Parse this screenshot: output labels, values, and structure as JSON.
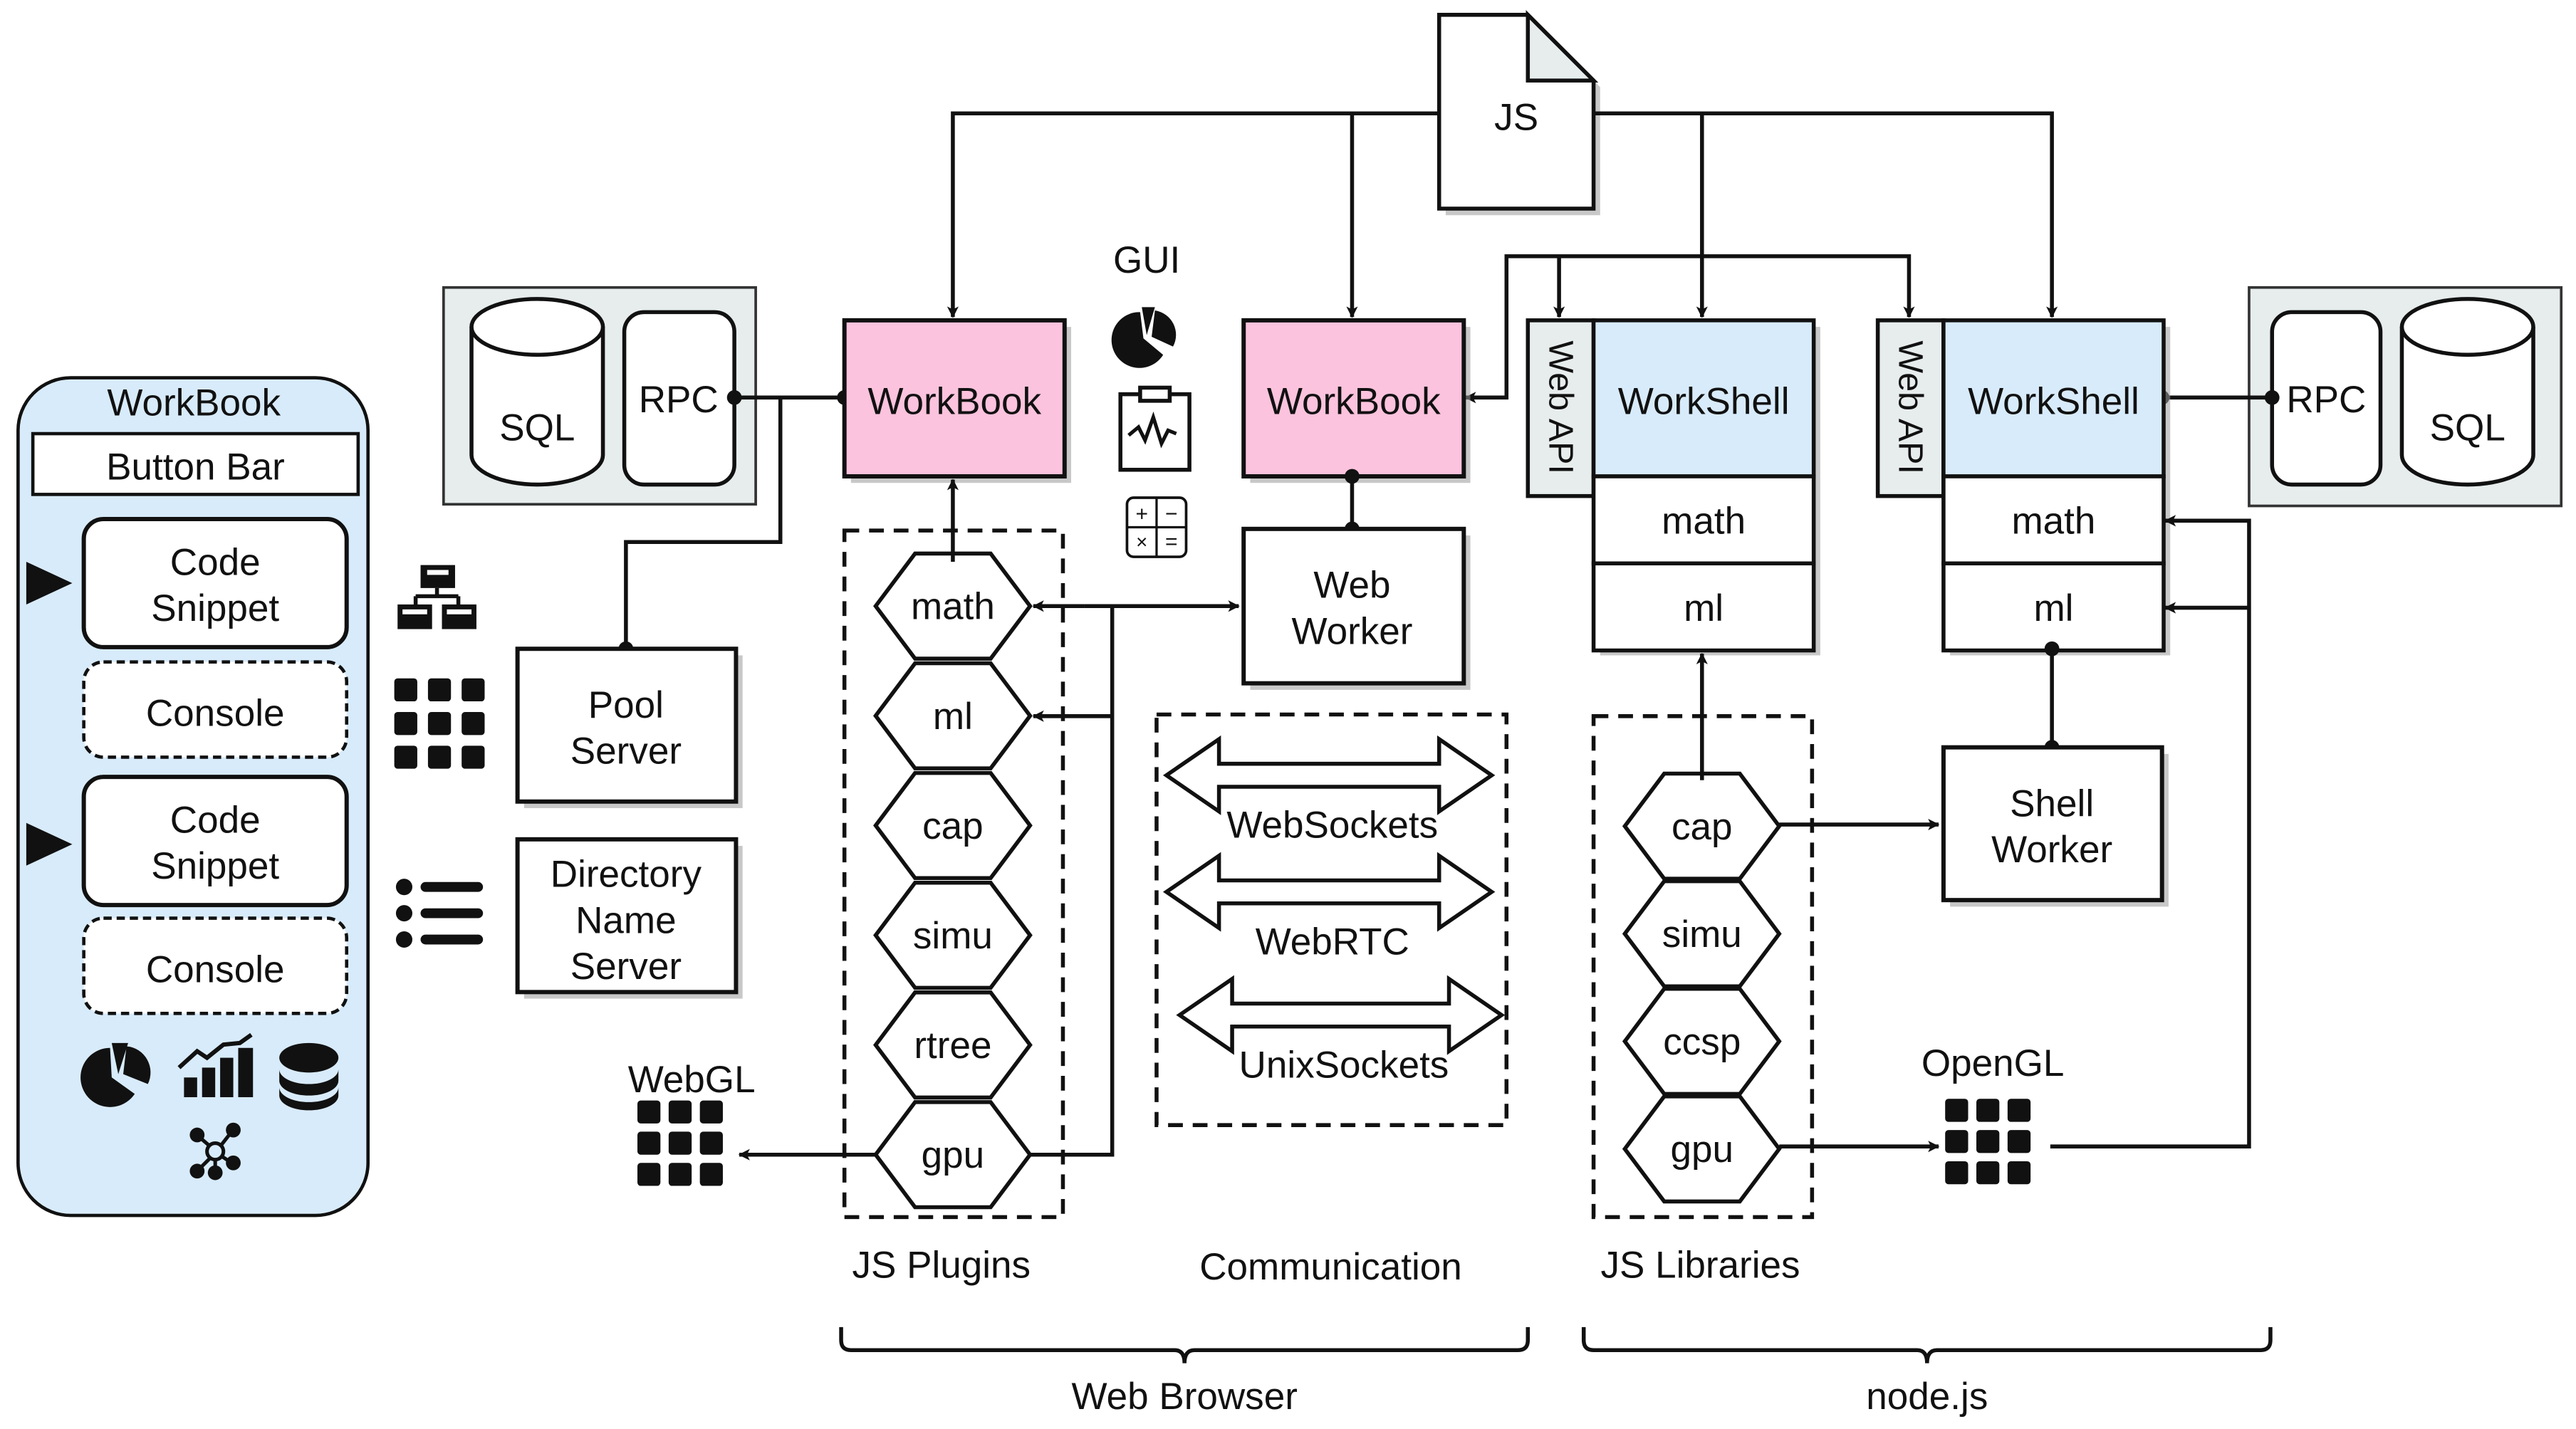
{
  "colors": {
    "workbook_fill": "#fbc3dd",
    "workshell_fill": "#d8ebfb",
    "panel_fill": "#d8ebfb",
    "store_fill": "#e7ecec",
    "webapi_fill": "#e7ecec",
    "ink": "#111111"
  },
  "left_panel": {
    "title": "WorkBook",
    "button_bar": "Button Bar",
    "cells": [
      {
        "kind": "code",
        "line1": "Code",
        "line2": "Snippet",
        "run_marker": "play-icon"
      },
      {
        "kind": "console",
        "label": "Console"
      },
      {
        "kind": "code",
        "line1": "Code",
        "line2": "Snippet",
        "run_marker": "play-icon"
      },
      {
        "kind": "console",
        "label": "Console"
      }
    ],
    "icons": [
      "pie-chart-icon",
      "bar-line-chart-icon",
      "database-icon",
      "network-graph-icon"
    ]
  },
  "left_store": {
    "db": "SQL",
    "rpc": "RPC"
  },
  "right_store": {
    "db": "SQL",
    "rpc": "RPC"
  },
  "js_file": {
    "label": "JS"
  },
  "gui": {
    "label": "GUI",
    "icons": [
      "pie-chart-icon",
      "clipboard-pulse-icon",
      "calculator-icon"
    ]
  },
  "workbooks": [
    {
      "label": "WorkBook"
    },
    {
      "label": "WorkBook"
    }
  ],
  "web_worker": {
    "line1": "Web",
    "line2": "Worker"
  },
  "pool_server": {
    "line1": "Pool",
    "line2": "Server",
    "icon": "hierarchy-icon"
  },
  "directory_server": {
    "line1": "Directory",
    "line2": "Name",
    "line3": "Server",
    "icon": "list-icon"
  },
  "grid_icon_label": "grid-icon",
  "js_plugins": {
    "caption": "JS Plugins",
    "items": [
      "math",
      "ml",
      "cap",
      "simu",
      "rtree",
      "gpu"
    ]
  },
  "webgl": {
    "label": "WebGL"
  },
  "communication": {
    "caption": "Communication",
    "channels": [
      "WebSockets",
      "WebRTC",
      "UnixSockets"
    ]
  },
  "workshells": [
    {
      "api": "Web API",
      "title": "WorkShell",
      "modules": [
        "math",
        "ml"
      ]
    },
    {
      "api": "Web API",
      "title": "WorkShell",
      "modules": [
        "math",
        "ml"
      ]
    }
  ],
  "js_libraries": {
    "caption": "JS Libraries",
    "items": [
      "cap",
      "simu",
      "ccsp",
      "gpu"
    ]
  },
  "shell_worker": {
    "line1": "Shell",
    "line2": "Worker"
  },
  "opengl": {
    "label": "OpenGL"
  },
  "groups": {
    "browser": "Web Browser",
    "node": "node.js"
  }
}
